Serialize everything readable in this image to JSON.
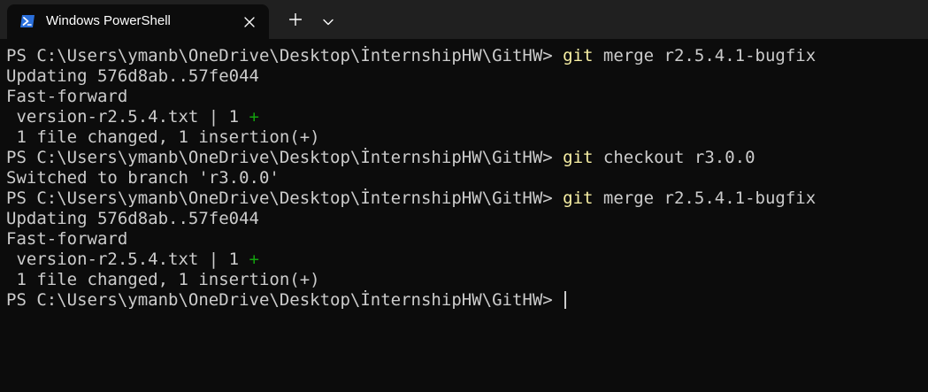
{
  "tab": {
    "title": "Windows PowerShell",
    "icon": "powershell-icon",
    "close_icon": "close-icon"
  },
  "titlebar": {
    "new_tab_icon": "plus-icon",
    "dropdown_icon": "chevron-down-icon"
  },
  "colors": {
    "terminal_bg": "#0c0c0c",
    "titlebar_bg": "#202020",
    "text": "#cccccc",
    "command": "#f9f1a5",
    "diff_plus": "#13a10e"
  },
  "terminal": {
    "prompt": "PS C:\\Users\\ymanb\\OneDrive\\Desktop\\İnternshipHW\\GitHW> ",
    "lines": [
      {
        "type": "prompt",
        "cmd": "git",
        "args": " merge r2.5.4.1-bugfix"
      },
      {
        "type": "output",
        "text": "Updating 576d8ab..57fe044"
      },
      {
        "type": "output",
        "text": "Fast-forward"
      },
      {
        "type": "diffstat",
        "text": " version-r2.5.4.txt | 1 ",
        "plus": "+"
      },
      {
        "type": "output",
        "text": " 1 file changed, 1 insertion(+)"
      },
      {
        "type": "prompt",
        "cmd": "git",
        "args": " checkout r3.0.0"
      },
      {
        "type": "output",
        "text": "Switched to branch 'r3.0.0'"
      },
      {
        "type": "prompt",
        "cmd": "git",
        "args": " merge r2.5.4.1-bugfix"
      },
      {
        "type": "output",
        "text": "Updating 576d8ab..57fe044"
      },
      {
        "type": "output",
        "text": "Fast-forward"
      },
      {
        "type": "diffstat",
        "text": " version-r2.5.4.txt | 1 ",
        "plus": "+"
      },
      {
        "type": "output",
        "text": " 1 file changed, 1 insertion(+)"
      },
      {
        "type": "prompt_cursor"
      }
    ]
  }
}
